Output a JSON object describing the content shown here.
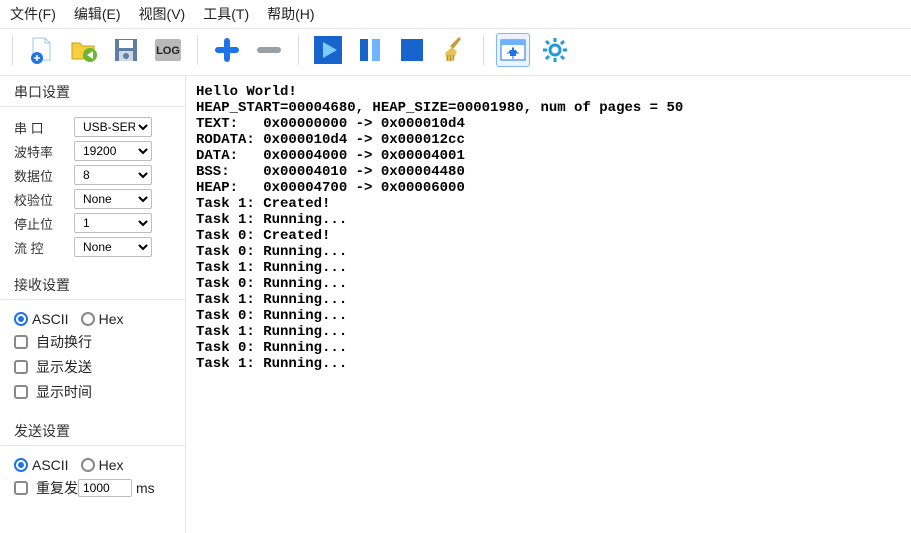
{
  "menubar": {
    "file": "文件(F)",
    "edit": "编辑(E)",
    "view": "视图(V)",
    "tools": "工具(T)",
    "help": "帮助(H)"
  },
  "sidebar": {
    "serial_section": "串口设置",
    "serial_rows": {
      "port_label": "串    口",
      "port_value": "USB-SER",
      "baud_label": "波特率",
      "baud_value": "19200",
      "databits_label": "数据位",
      "databits_value": "8",
      "parity_label": "校验位",
      "parity_value": "None",
      "stopbits_label": "停止位",
      "stopbits_value": "1",
      "flow_label": "流    控",
      "flow_value": "None"
    },
    "recv_section": "接收设置",
    "recv": {
      "ascii": "ASCII",
      "hex": "Hex",
      "wrap": "自动换行",
      "show_send": "显示发送",
      "show_time": "显示时间"
    },
    "send_section": "发送设置",
    "send": {
      "ascii": "ASCII",
      "hex": "Hex",
      "repeat_label": "重复发",
      "repeat_value": "1000",
      "repeat_unit": "ms"
    }
  },
  "console": "Hello World!\nHEAP_START=00004680, HEAP_SIZE=00001980, num of pages = 50\nTEXT:   0x00000000 -> 0x000010d4\nRODATA: 0x000010d4 -> 0x000012cc\nDATA:   0x00004000 -> 0x00004001\nBSS:    0x00004010 -> 0x00004480\nHEAP:   0x00004700 -> 0x00006000\nTask 1: Created!\nTask 1: Running...\nTask 0: Created!\nTask 0: Running...\nTask 1: Running...\nTask 0: Running...\nTask 1: Running...\nTask 0: Running...\nTask 1: Running...\nTask 0: Running...\nTask 1: Running..."
}
